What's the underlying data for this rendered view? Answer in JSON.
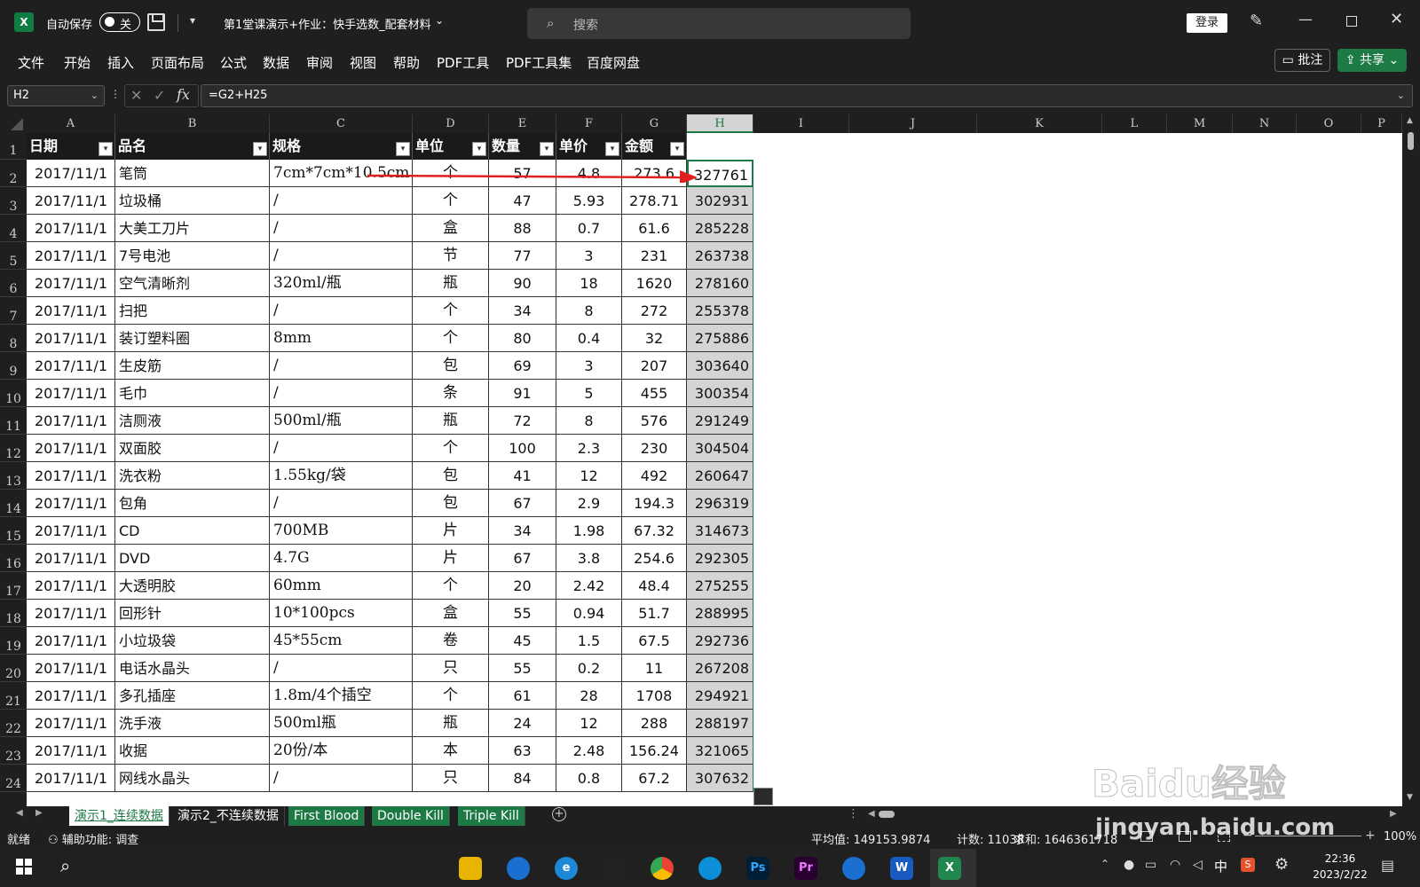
{
  "titlebar": {
    "app_icon": "X",
    "autosave_label": "自动保存",
    "autosave_state": "关",
    "doc_title": "第1堂课演示+作业：快手选数_配套材料",
    "search_placeholder": "搜索",
    "login": "登录"
  },
  "ribbon": {
    "tabs": [
      "文件",
      "开始",
      "插入",
      "页面布局",
      "公式",
      "数据",
      "审阅",
      "视图",
      "帮助",
      "PDF工具",
      "PDF工具集",
      "百度网盘"
    ],
    "comment": "批注",
    "share": "共享"
  },
  "formula_bar": {
    "name_box": "H2",
    "formula": "=G2+H25"
  },
  "columns": [
    "A",
    "B",
    "C",
    "D",
    "E",
    "F",
    "G",
    "H",
    "I",
    "J",
    "K",
    "L",
    "M",
    "N",
    "O",
    "P"
  ],
  "headers": [
    "日期",
    "品名",
    "规格",
    "单位",
    "数量",
    "单价",
    "金额"
  ],
  "rows": [
    {
      "n": "2",
      "a": "2017/11/1",
      "b": "笔筒",
      "c": "7cm*7cm*10.5cm",
      "d": "个",
      "e": "57",
      "f": "4.8",
      "g": "273.6",
      "h": "327761"
    },
    {
      "n": "3",
      "a": "2017/11/1",
      "b": "垃圾桶",
      "c": "/",
      "d": "个",
      "e": "47",
      "f": "5.93",
      "g": "278.71",
      "h": "302931"
    },
    {
      "n": "4",
      "a": "2017/11/1",
      "b": "大美工刀片",
      "c": "/",
      "d": "盒",
      "e": "88",
      "f": "0.7",
      "g": "61.6",
      "h": "285228"
    },
    {
      "n": "5",
      "a": "2017/11/1",
      "b": "7号电池",
      "c": "/",
      "d": "节",
      "e": "77",
      "f": "3",
      "g": "231",
      "h": "263738"
    },
    {
      "n": "6",
      "a": "2017/11/1",
      "b": "空气清晰剂",
      "c": "320ml/瓶",
      "d": "瓶",
      "e": "90",
      "f": "18",
      "g": "1620",
      "h": "278160"
    },
    {
      "n": "7",
      "a": "2017/11/1",
      "b": "扫把",
      "c": "/",
      "d": "个",
      "e": "34",
      "f": "8",
      "g": "272",
      "h": "255378"
    },
    {
      "n": "8",
      "a": "2017/11/1",
      "b": "装订塑料圈",
      "c": "8mm",
      "d": "个",
      "e": "80",
      "f": "0.4",
      "g": "32",
      "h": "275886"
    },
    {
      "n": "9",
      "a": "2017/11/1",
      "b": "生皮筋",
      "c": "/",
      "d": "包",
      "e": "69",
      "f": "3",
      "g": "207",
      "h": "303640"
    },
    {
      "n": "10",
      "a": "2017/11/1",
      "b": "毛巾",
      "c": "/",
      "d": "条",
      "e": "91",
      "f": "5",
      "g": "455",
      "h": "300354"
    },
    {
      "n": "11",
      "a": "2017/11/1",
      "b": "洁厕液",
      "c": "500ml/瓶",
      "d": "瓶",
      "e": "72",
      "f": "8",
      "g": "576",
      "h": "291249"
    },
    {
      "n": "12",
      "a": "2017/11/1",
      "b": "双面胶",
      "c": "/",
      "d": "个",
      "e": "100",
      "f": "2.3",
      "g": "230",
      "h": "304504"
    },
    {
      "n": "13",
      "a": "2017/11/1",
      "b": "洗衣粉",
      "c": "1.55kg/袋",
      "d": "包",
      "e": "41",
      "f": "12",
      "g": "492",
      "h": "260647"
    },
    {
      "n": "14",
      "a": "2017/11/1",
      "b": "包角",
      "c": "/",
      "d": "包",
      "e": "67",
      "f": "2.9",
      "g": "194.3",
      "h": "296319"
    },
    {
      "n": "15",
      "a": "2017/11/1",
      "b": "CD",
      "c": "700MB",
      "d": "片",
      "e": "34",
      "f": "1.98",
      "g": "67.32",
      "h": "314673"
    },
    {
      "n": "16",
      "a": "2017/11/1",
      "b": "DVD",
      "c": "4.7G",
      "d": "片",
      "e": "67",
      "f": "3.8",
      "g": "254.6",
      "h": "292305"
    },
    {
      "n": "17",
      "a": "2017/11/1",
      "b": "大透明胶",
      "c": "60mm",
      "d": "个",
      "e": "20",
      "f": "2.42",
      "g": "48.4",
      "h": "275255"
    },
    {
      "n": "18",
      "a": "2017/11/1",
      "b": "回形针",
      "c": "10*100pcs",
      "d": "盒",
      "e": "55",
      "f": "0.94",
      "g": "51.7",
      "h": "288995"
    },
    {
      "n": "19",
      "a": "2017/11/1",
      "b": "小垃圾袋",
      "c": "45*55cm",
      "d": "卷",
      "e": "45",
      "f": "1.5",
      "g": "67.5",
      "h": "292736"
    },
    {
      "n": "20",
      "a": "2017/11/1",
      "b": "电话水晶头",
      "c": "/",
      "d": "只",
      "e": "55",
      "f": "0.2",
      "g": "11",
      "h": "267208"
    },
    {
      "n": "21",
      "a": "2017/11/1",
      "b": "多孔插座",
      "c": "1.8m/4个插空",
      "d": "个",
      "e": "61",
      "f": "28",
      "g": "1708",
      "h": "294921"
    },
    {
      "n": "22",
      "a": "2017/11/1",
      "b": "洗手液",
      "c": "500ml瓶",
      "d": "瓶",
      "e": "24",
      "f": "12",
      "g": "288",
      "h": "288197"
    },
    {
      "n": "23",
      "a": "2017/11/1",
      "b": "收据",
      "c": "20份/本",
      "d": "本",
      "e": "63",
      "f": "2.48",
      "g": "156.24",
      "h": "321065"
    },
    {
      "n": "24",
      "a": "2017/11/1",
      "b": "网线水晶头",
      "c": "/",
      "d": "只",
      "e": "84",
      "f": "0.8",
      "g": "67.2",
      "h": "307632"
    }
  ],
  "sheet_tabs": [
    "演示1_连续数据",
    "演示2_不连续数据",
    "First Blood",
    "Double Kill",
    "Triple Kill"
  ],
  "status": {
    "ready": "就绪",
    "accessibility": "辅助功能: 调查",
    "average": "平均值: 149153.9874",
    "count": "计数: 11038",
    "sum": "求和: 1646361718",
    "zoom": "100%"
  },
  "taskbar": {
    "time": "22:36",
    "date": "2023/2/22",
    "ime": "中",
    "apps": [
      "Ps",
      "Pr"
    ]
  },
  "watermark": {
    "brand": "Baidu经验",
    "url": "jingyan.baidu.com"
  },
  "colors": {
    "accent_green": "#1e7a45",
    "selected_col": "#d4d4d4",
    "arrow": "#e02020"
  }
}
